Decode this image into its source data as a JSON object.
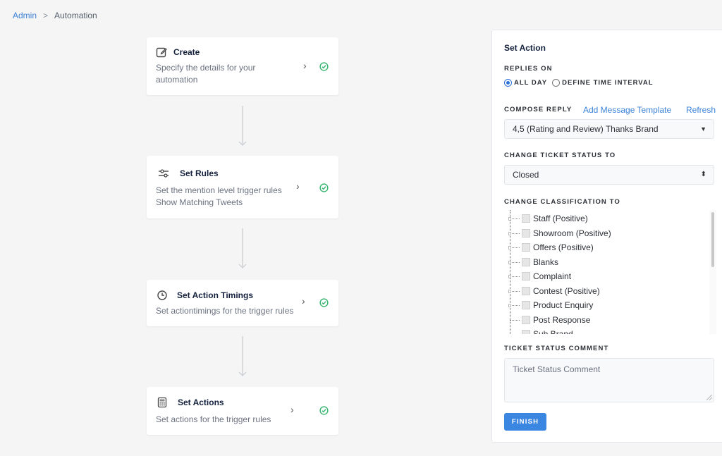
{
  "breadcrumb": {
    "parent": "Admin",
    "separator": ">",
    "current": "Automation"
  },
  "steps": [
    {
      "title": "Create",
      "icon": "edit-icon",
      "desc_lines": [
        "Specify the details for your",
        "automation"
      ],
      "status": "complete"
    },
    {
      "title": "Set Rules",
      "icon": "sliders-icon",
      "desc_lines": [
        "Set the mention level trigger rules",
        "Show Matching Tweets"
      ],
      "status": "complete"
    },
    {
      "title": "Set Action Timings",
      "icon": "clock-icon",
      "desc_lines": [
        "Set actiontimings for the trigger rules"
      ],
      "status": "complete"
    },
    {
      "title": "Set Actions",
      "icon": "calculator-icon",
      "desc_lines": [
        "Set actions for the trigger rules"
      ],
      "status": "complete"
    }
  ],
  "panel": {
    "title": "Set Action",
    "replies_on": {
      "label": "REPLIES ON",
      "options": [
        {
          "label": "ALL DAY",
          "selected": true
        },
        {
          "label": "DEFINE TIME INTERVAL",
          "selected": false
        }
      ]
    },
    "compose_reply": {
      "label": "COMPOSE REPLY",
      "add_template_link": "Add Message Template",
      "refresh_link": "Refresh",
      "selected": "4,5 (Rating and Review) Thanks Brand"
    },
    "ticket_status": {
      "label": "CHANGE TICKET STATUS TO",
      "selected": "Closed"
    },
    "classification": {
      "label": "CHANGE CLASSIFICATION TO",
      "items": [
        {
          "label": "Staff (Positive)",
          "checked": false,
          "expandable": true
        },
        {
          "label": "Showroom (Positive)",
          "checked": false,
          "expandable": true
        },
        {
          "label": "Offers (Positive)",
          "checked": false,
          "expandable": true
        },
        {
          "label": "Blanks",
          "checked": false,
          "expandable": true
        },
        {
          "label": "Complaint",
          "checked": false,
          "expandable": true
        },
        {
          "label": "Contest (Positive)",
          "checked": false,
          "expandable": true
        },
        {
          "label": "Product Enquiry",
          "checked": false,
          "expandable": true
        },
        {
          "label": "Post Response",
          "checked": false,
          "expandable": false
        },
        {
          "label": "Sub Brand",
          "checked": false,
          "expandable": false
        }
      ]
    },
    "comment": {
      "label": "TICKET STATUS COMMENT",
      "placeholder": "Ticket Status Comment",
      "value": ""
    },
    "finish_label": "FINISH"
  },
  "colors": {
    "accent": "#3b86e0",
    "link": "#3b82d8",
    "success": "#2fb36a"
  }
}
